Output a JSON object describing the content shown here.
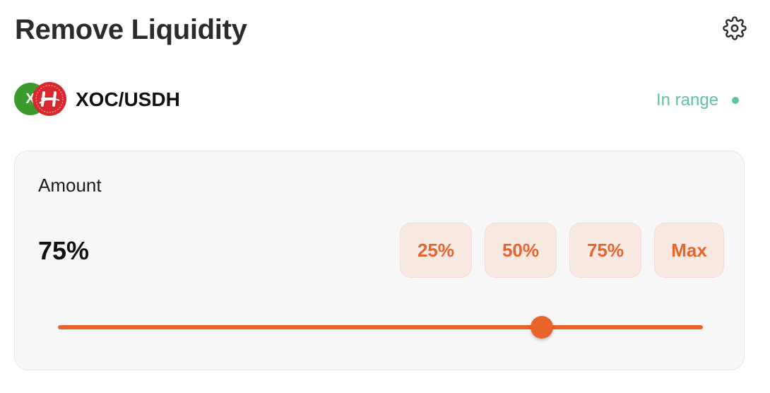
{
  "header": {
    "title": "Remove Liquidity",
    "settings_icon": "gear-icon"
  },
  "pair": {
    "name": "XOC/USDH",
    "token_a": {
      "icon": "xoc-token-icon",
      "letter": "X",
      "color": "#3c9b2d"
    },
    "token_b": {
      "icon": "usdh-token-icon",
      "color": "#d8282e"
    },
    "status": "In range",
    "status_color": "#5ec39e"
  },
  "amount": {
    "label": "Amount",
    "value": "75%",
    "percent": 75,
    "presets": [
      "25%",
      "50%",
      "75%",
      "Max"
    ]
  },
  "colors": {
    "accent": "#e8642c",
    "preset_bg": "#f8e9e3",
    "card_bg": "#f7f7f7"
  }
}
